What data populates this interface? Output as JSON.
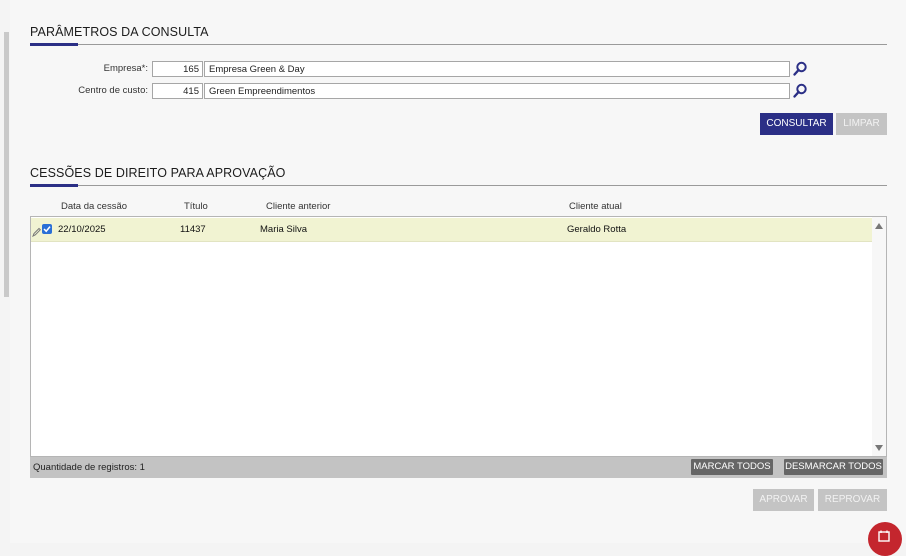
{
  "params": {
    "title": "PARÂMETROS DA CONSULTA",
    "empresa": {
      "label": "Empresa*:",
      "code": "165",
      "name": "Empresa Green & Day"
    },
    "centro": {
      "label": "Centro de custo:",
      "code": "415",
      "name": "Green Empreendimentos"
    },
    "consultar_label": "CONSULTAR",
    "limpar_label": "LIMPAR"
  },
  "cessoes": {
    "title": "CESSÕES DE DIREITO PARA APROVAÇÃO",
    "columns": [
      "Data da cessão",
      "Título",
      "Cliente anterior",
      "Cliente atual"
    ],
    "rows": [
      {
        "data": "22/10/2025",
        "titulo": "11437",
        "cliente_anterior": "Maria Silva",
        "cliente_atual": "Geraldo Rotta",
        "checked": true
      }
    ],
    "footer_count": "Quantidade de registros: 1",
    "marcar_label": "MARCAR TODOS",
    "desmarcar_label": "DESMARCAR TODOS",
    "aprovar_label": "APROVAR",
    "reprovar_label": "REPROVAR"
  },
  "colors": {
    "accent": "#2b2f86",
    "row_highlight": "#f1f3d2",
    "disabled": "#c4c4c4",
    "badge": "#c4262e"
  },
  "icons": {
    "lookup": "search-icon",
    "row_edit": "pencil-icon",
    "row_check": "checkbox-icon",
    "scroll_up": "arrow-up-icon",
    "scroll_down": "arrow-down-icon",
    "badge": "notification-icon"
  }
}
